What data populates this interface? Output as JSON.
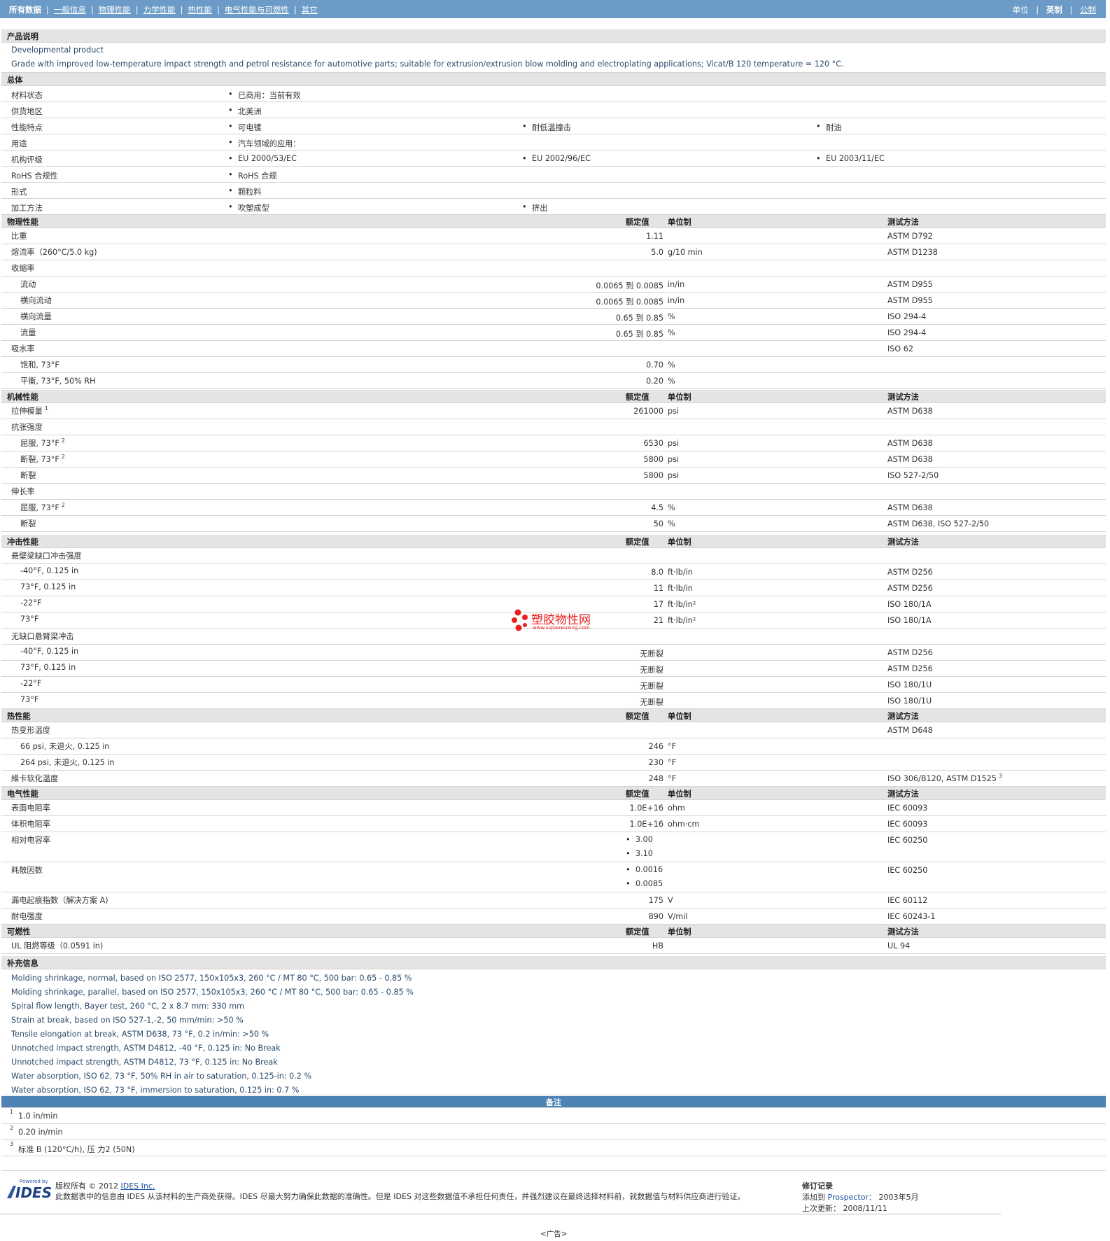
{
  "nav": {
    "items": [
      "所有数据",
      "一般信息",
      "物理性能",
      "力学性能",
      "热性能",
      "电气性能与可燃性",
      "其它"
    ],
    "units_label": "单位",
    "units_active": "英制",
    "units_other": "公制"
  },
  "product": {
    "heading": "产品说明",
    "line1": "Developmental product",
    "line2": "Grade with improved low-temperature impact strength and petrol resistance for automotive parts; suitable for extrusion/extrusion blow molding and electroplating applications; Vicat/B 120 temperature = 120 °C."
  },
  "general": {
    "heading": "总体",
    "rows": [
      {
        "label": "材料状态",
        "values": [
          "已商用：当前有效"
        ]
      },
      {
        "label": "供货地区",
        "values": [
          "北美洲"
        ]
      },
      {
        "label": "性能特点",
        "values": [
          "可电镀",
          "耐低温撞击",
          "耐油"
        ]
      },
      {
        "label": "用途",
        "values": [
          "汽车领域的应用："
        ]
      },
      {
        "label": "机构评级",
        "values": [
          "EU 2000/53/EC",
          "EU 2002/96/EC",
          "EU 2003/11/EC"
        ]
      },
      {
        "label": "RoHS 合规性",
        "values": [
          "RoHS 合规"
        ]
      },
      {
        "label": "形式",
        "values": [
          "颗粒料"
        ]
      },
      {
        "label": "加工方法",
        "values": [
          "吹塑成型",
          "挤出"
        ]
      }
    ]
  },
  "cols": {
    "nominal": "额定值",
    "unit": "单位制",
    "method": "测试方法"
  },
  "physical": {
    "heading": "物理性能",
    "rows": [
      {
        "label": "比重",
        "value": "1.11",
        "unit": "",
        "method": "ASTM D792"
      },
      {
        "label": "熔流率（260°C/5.0 kg)",
        "value": "5.0",
        "unit": "g/10 min",
        "method": "ASTM D1238"
      },
      {
        "label": "收缩率",
        "value": "",
        "unit": "",
        "method": ""
      },
      {
        "label": "流动",
        "value": "0.0065 到  0.0085",
        "unit": "in/in",
        "method": "ASTM D955",
        "sub": true
      },
      {
        "label": "横向流动",
        "value": "0.0065 到  0.0085",
        "unit": "in/in",
        "method": "ASTM D955",
        "sub": true
      },
      {
        "label": "横向流量",
        "value": "0.65 到  0.85",
        "unit": "%",
        "method": "ISO 294-4",
        "sub": true
      },
      {
        "label": "流量",
        "value": "0.65 到  0.85",
        "unit": "%",
        "method": "ISO 294-4",
        "sub": true
      },
      {
        "label": "吸水率",
        "value": "",
        "unit": "",
        "method": "ISO 62"
      },
      {
        "label": "饱和, 73°F",
        "value": "0.70",
        "unit": "%",
        "method": "",
        "sub": true
      },
      {
        "label": "平衡, 73°F, 50% RH",
        "value": "0.20",
        "unit": "%",
        "method": "",
        "sub": true
      }
    ]
  },
  "mechanical": {
    "heading": "机械性能",
    "rows": [
      {
        "label": "拉伸模量",
        "sup": "1",
        "value": "261000",
        "unit": "psi",
        "method": "ASTM D638"
      },
      {
        "label": "抗张强度",
        "value": "",
        "unit": "",
        "method": ""
      },
      {
        "label": "屈服, 73°F",
        "sup": "2",
        "value": "6530",
        "unit": "psi",
        "method": "ASTM D638",
        "sub": true
      },
      {
        "label": "断裂, 73°F",
        "sup": "2",
        "value": "5800",
        "unit": "psi",
        "method": "ASTM D638",
        "sub": true
      },
      {
        "label": "断裂",
        "value": "5800",
        "unit": "psi",
        "method": "ISO 527-2/50",
        "sub": true
      },
      {
        "label": "伸长率",
        "value": "",
        "unit": "",
        "method": ""
      },
      {
        "label": "屈服, 73°F",
        "sup": "2",
        "value": "4.5",
        "unit": "%",
        "method": "ASTM D638",
        "sub": true
      },
      {
        "label": "断裂",
        "value": "50",
        "unit": "%",
        "method": "ASTM D638, ISO 527-2/50",
        "sub": true
      }
    ]
  },
  "impact": {
    "heading": "冲击性能",
    "rows": [
      {
        "label": "悬壁梁缺口冲击强度",
        "value": "",
        "unit": "",
        "method": ""
      },
      {
        "label": "-40°F, 0.125 in",
        "value": "8.0",
        "unit": "ft·lb/in",
        "method": "ASTM D256",
        "sub": true
      },
      {
        "label": "73°F, 0.125 in",
        "value": "11",
        "unit": "ft·lb/in",
        "method": "ASTM D256",
        "sub": true
      },
      {
        "label": "-22°F",
        "value": "17",
        "unit": "ft·lb/in²",
        "method": "ISO 180/1A",
        "sub": true
      },
      {
        "label": "73°F",
        "value": "21",
        "unit": "ft·lb/in²",
        "method": "ISO 180/1A",
        "sub": true
      },
      {
        "label": "无缺口悬臂梁冲击",
        "value": "",
        "unit": "",
        "method": ""
      },
      {
        "label": "-40°F, 0.125 in",
        "value": "无断裂",
        "unit": "",
        "method": "ASTM D256",
        "sub": true
      },
      {
        "label": "73°F, 0.125 in",
        "value": "无断裂",
        "unit": "",
        "method": "ASTM D256",
        "sub": true
      },
      {
        "label": "-22°F",
        "value": "无断裂",
        "unit": "",
        "method": "ISO 180/1U",
        "sub": true
      },
      {
        "label": "73°F",
        "value": "无断裂",
        "unit": "",
        "method": "ISO 180/1U",
        "sub": true
      }
    ]
  },
  "thermal": {
    "heading": "热性能",
    "rows": [
      {
        "label": "热变形温度",
        "value": "",
        "unit": "",
        "method": "ASTM D648"
      },
      {
        "label": "66 psi, 未退火, 0.125 in",
        "value": "246",
        "unit": "°F",
        "method": "",
        "sub": true
      },
      {
        "label": "264 psi, 未退火, 0.125 in",
        "value": "230",
        "unit": "°F",
        "method": "",
        "sub": true
      },
      {
        "label": "維卡软化温度",
        "value": "248",
        "unit": "°F",
        "method": "ISO 306/B120, ASTM D1525",
        "msup": "3"
      }
    ]
  },
  "electrical": {
    "heading": "电气性能",
    "rows": [
      {
        "label": "表面电阻率",
        "value": "1.0E+16",
        "unit": "ohm",
        "method": "IEC 60093"
      },
      {
        "label": "体积电阻率",
        "value": "1.0E+16",
        "unit": "ohm·cm",
        "method": "IEC 60093"
      },
      {
        "label": "相对电容率",
        "values": [
          "3.00",
          "3.10"
        ],
        "method": "IEC 60250"
      },
      {
        "label": "耗散因数",
        "values": [
          "0.0016",
          "0.0085"
        ],
        "method": "IEC 60250"
      },
      {
        "label": "漏电起痕指数（解决方案 A)",
        "value": "175",
        "unit": "V",
        "method": "IEC 60112"
      },
      {
        "label": "耐电强度",
        "value": "890",
        "unit": "V/mil",
        "method": "IEC 60243-1"
      }
    ]
  },
  "flammability": {
    "heading": "可燃性",
    "rows": [
      {
        "label": "UL 阻燃等级（0.0591 in)",
        "value": "HB",
        "unit": "",
        "method": "UL 94"
      }
    ]
  },
  "supplement": {
    "heading": "补充信息",
    "lines": [
      "Molding shrinkage, normal, based on ISO 2577, 150x105x3, 260 °C / MT 80 °C, 500 bar: 0.65 - 0.85 %",
      "Molding shrinkage, parallel, based on ISO 2577, 150x105x3, 260 °C / MT 80 °C, 500 bar: 0.65 - 0.85 %",
      "Spiral flow length, Bayer test, 260 °C, 2 x 8.7 mm: 330 mm",
      "Strain at break, based on ISO 527-1,-2, 50 mm/min: >50 %",
      "Tensile elongation at break, ASTM D638, 73 °F, 0.2 in/min: >50 %",
      "Unnotched impact strength, ASTM D4812, -40 °F, 0.125 in: No Break",
      "Unnotched impact strength, ASTM D4812, 73 °F, 0.125 in: No Break",
      "Water absorption, ISO 62, 73 °F, 50% RH in air to saturation, 0.125-in: 0.2 %",
      "Water absorption, ISO 62, 73 °F, immersion to saturation, 0.125 in: 0.7 %"
    ]
  },
  "notes": {
    "heading": "备注",
    "items": [
      {
        "n": "1",
        "text": "1.0 in/min"
      },
      {
        "n": "2",
        "text": "0.20 in/min"
      },
      {
        "n": "3",
        "text": "标准 B (120°C/h), 压 力2 (50N)"
      }
    ]
  },
  "watermark": {
    "title": "塑胶物性网",
    "url": "www.sujiaowuxing.com"
  },
  "footer": {
    "logo_small": "Powered by",
    "logo": "IDES",
    "copyright_prefix": "版权所有 © 2012",
    "copyright_link": "IDES Inc.",
    "disclaimer": "此数据表中的信息由 IDES 从该材料的生产商处获得。IDES 尽最大努力确保此数据的准确性。但是 IDES 对这些数据值不承担任何责任，并强烈建议在最终选择材料前，就数据值与材料供应商进行验证。",
    "revision_heading": "修订记录",
    "added_label": "添加到",
    "added_link": "Prospector：",
    "added_date": "2003年5月",
    "updated_label": "上次更新：",
    "updated_date": "2008/11/11",
    "ad": "<广告>"
  },
  "colors": {
    "topbar": "#6b9bc6",
    "section_bg": "#e4e4e4",
    "notes_bar": "#4d83b5",
    "watermark_red": "#e8201f"
  }
}
